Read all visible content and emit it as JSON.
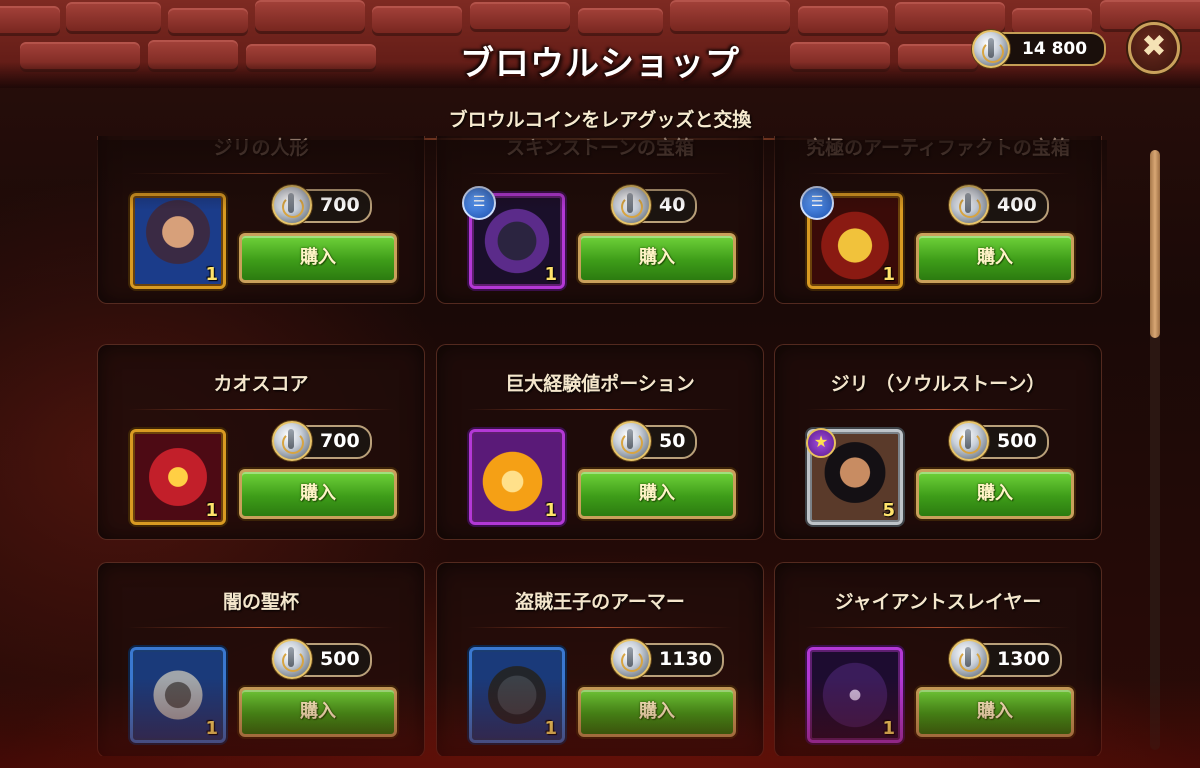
{
  "header": {
    "title": "ブロウルショップ",
    "subtitle": "ブロウルコインをレアグッズと交換",
    "coin_balance": "14 800",
    "close_icon": "close-x-icon"
  },
  "shop": {
    "buy_label": "購入",
    "items": [
      {
        "name": "ジリの人形",
        "price": "700",
        "qty": "1",
        "frame": "gold",
        "icon": "doll-icon"
      },
      {
        "name": "スキンストーンの宝箱",
        "price": "40",
        "qty": "1",
        "frame": "purple",
        "icon": "skin-stone-chest-icon",
        "info": true
      },
      {
        "name": "究極のアーティファクトの宝箱",
        "price": "400",
        "qty": "1",
        "frame": "gold",
        "icon": "artifact-chest-icon",
        "info": true
      },
      {
        "name": "カオスコア",
        "price": "700",
        "qty": "1",
        "frame": "gold",
        "icon": "chaos-core-icon"
      },
      {
        "name": "巨大経験値ポーション",
        "price": "50",
        "qty": "1",
        "frame": "purple",
        "icon": "xp-potion-icon"
      },
      {
        "name": "ジリ （ソウルストーン）",
        "price": "500",
        "qty": "5",
        "frame": "silver",
        "icon": "hero-portrait-icon",
        "star": true
      },
      {
        "name": "闇の聖杯",
        "price": "500",
        "qty": "1",
        "frame": "blue",
        "icon": "dark-grail-icon"
      },
      {
        "name": "盗賊王子のアーマー",
        "price": "1130",
        "qty": "1",
        "frame": "blue",
        "icon": "armor-icon"
      },
      {
        "name": "ジャイアントスレイヤー",
        "price": "1300",
        "qty": "1",
        "frame": "purple",
        "icon": "bow-icon"
      }
    ]
  },
  "colors": {
    "buy_green": "#4fb024",
    "gold_frame": "#d99a22",
    "purple_frame": "#b338d6",
    "blue_frame": "#3a78d0"
  }
}
